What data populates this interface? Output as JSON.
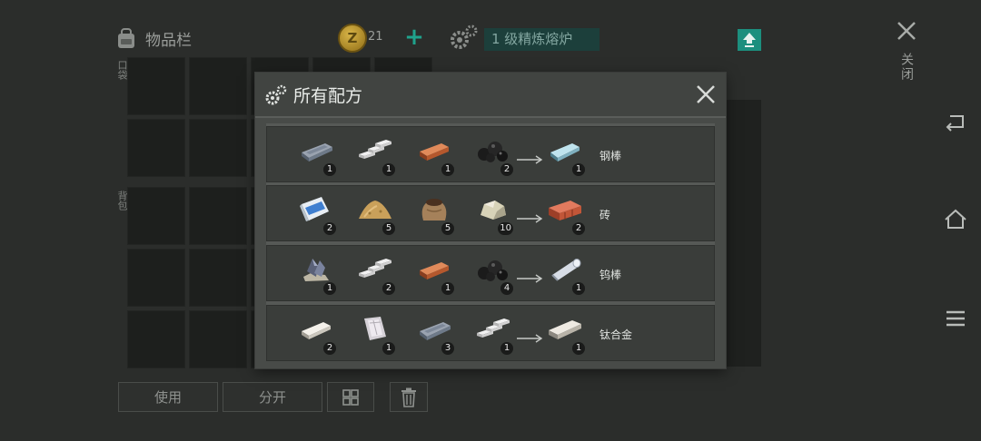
{
  "inventory": {
    "title": "物品栏",
    "pocket_label": "口袋",
    "backpack_label": "背包",
    "coins": "21",
    "coin_symbol": "Z"
  },
  "furnace": {
    "label": "1 级精炼熔炉"
  },
  "close_label": "关闭",
  "actions": {
    "use": "使用",
    "split": "分开"
  },
  "modal": {
    "title": "所有配方",
    "recipes": [
      {
        "inputs": [
          {
            "item": "iron-bar",
            "qty": "1"
          },
          {
            "item": "silver-ingots",
            "qty": "1"
          },
          {
            "item": "copper-bar",
            "qty": "1"
          },
          {
            "item": "coal",
            "qty": "2"
          }
        ],
        "output": {
          "item": "steel-rod",
          "qty": "1"
        },
        "name": "钢棒"
      },
      {
        "inputs": [
          {
            "item": "cement-bag",
            "qty": "2"
          },
          {
            "item": "sand-pile",
            "qty": "5"
          },
          {
            "item": "dirt-sack",
            "qty": "5"
          },
          {
            "item": "stone",
            "qty": "10"
          }
        ],
        "output": {
          "item": "brick",
          "qty": "2"
        },
        "name": "砖"
      },
      {
        "inputs": [
          {
            "item": "tungsten-ore",
            "qty": "1"
          },
          {
            "item": "silver-ingots",
            "qty": "2"
          },
          {
            "item": "copper-bar",
            "qty": "1"
          },
          {
            "item": "coal",
            "qty": "4"
          }
        ],
        "output": {
          "item": "tungsten-rod",
          "qty": "1"
        },
        "name": "钨棒"
      },
      {
        "inputs": [
          {
            "item": "white-ingot",
            "qty": "2"
          },
          {
            "item": "titanium-sheet",
            "qty": "1"
          },
          {
            "item": "iron-bar",
            "qty": "3"
          },
          {
            "item": "silver-ingots",
            "qty": "1"
          }
        ],
        "output": {
          "item": "titanium-alloy",
          "qty": "1"
        },
        "name": "钛合金"
      }
    ]
  },
  "colors": {
    "accent": "#1c8f7e",
    "furnace_bg": "#1c3f3b",
    "modal_bg": "#484b48"
  }
}
